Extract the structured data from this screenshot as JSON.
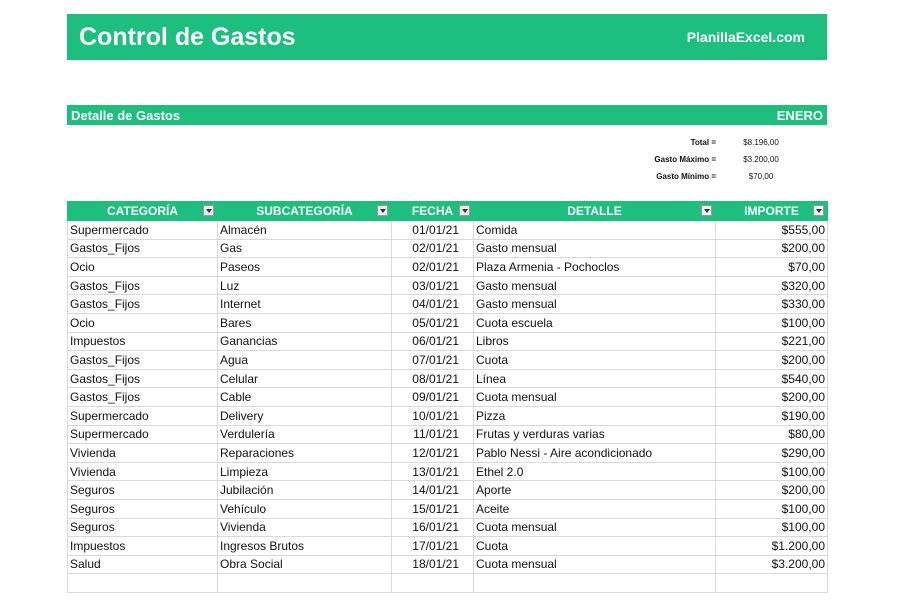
{
  "header": {
    "title": "Control de Gastos",
    "site": "PlanillaExcel.com"
  },
  "section": {
    "title": "Detalle de Gastos",
    "month": "ENERO"
  },
  "summary": [
    {
      "label": "Total =",
      "value": "$8.196,00"
    },
    {
      "label": "Gasto Máximo =",
      "value": "$3.200,00"
    },
    {
      "label": "Gasto Mínimo =",
      "value": "$70,00"
    }
  ],
  "table": {
    "headers": [
      "CATEGORÍA",
      "SUBCATEGORÍA",
      "FECHA",
      "DETALLE",
      "IMPORTE"
    ],
    "rows": [
      [
        "Supermercado",
        "Almacén",
        "01/01/21",
        "Comida",
        "$555,00"
      ],
      [
        "Gastos_Fijos",
        "Gas",
        "02/01/21",
        "Gasto mensual",
        "$200,00"
      ],
      [
        "Ocio",
        "Paseos",
        "02/01/21",
        "Plaza Armenia - Pochoclos",
        "$70,00"
      ],
      [
        "Gastos_Fijos",
        "Luz",
        "03/01/21",
        "Gasto mensual",
        "$320,00"
      ],
      [
        "Gastos_Fijos",
        "Internet",
        "04/01/21",
        "Gasto mensual",
        "$330,00"
      ],
      [
        "Ocio",
        "Bares",
        "05/01/21",
        "Cuota escuela",
        "$100,00"
      ],
      [
        "Impuestos",
        "Ganancias",
        "06/01/21",
        "Libros",
        "$221,00"
      ],
      [
        "Gastos_Fijos",
        "Agua",
        "07/01/21",
        "Cuota",
        "$200,00"
      ],
      [
        "Gastos_Fijos",
        "Celular",
        "08/01/21",
        "Línea",
        "$540,00"
      ],
      [
        "Gastos_Fijos",
        "Cable",
        "09/01/21",
        "Cuota mensual",
        "$200,00"
      ],
      [
        "Supermercado",
        "Delivery",
        "10/01/21",
        "Pizza",
        "$190,00"
      ],
      [
        "Supermercado",
        "Verdulería",
        "11/01/21",
        "Frutas y verduras varias",
        "$80,00"
      ],
      [
        "Vivienda",
        "Reparaciones",
        "12/01/21",
        "Pablo Nessi - Aire acondicionado",
        "$290,00"
      ],
      [
        "Vivienda",
        "Limpieza",
        "13/01/21",
        "Ethel 2.0",
        "$100,00"
      ],
      [
        "Seguros",
        "Jubilación",
        "14/01/21",
        "Aporte",
        "$200,00"
      ],
      [
        "Seguros",
        "Vehículo",
        "15/01/21",
        "Aceite",
        "$100,00"
      ],
      [
        "Seguros",
        "Vivienda",
        "16/01/21",
        "Cuota mensual",
        "$100,00"
      ],
      [
        "Impuestos",
        "Ingresos Brutos",
        "17/01/21",
        "Cuota",
        "$1.200,00"
      ],
      [
        "Salud",
        "Obra Social",
        "18/01/21",
        "Cuota mensual",
        "$3.200,00"
      ],
      [
        "",
        "",
        "",
        "",
        ""
      ]
    ]
  }
}
